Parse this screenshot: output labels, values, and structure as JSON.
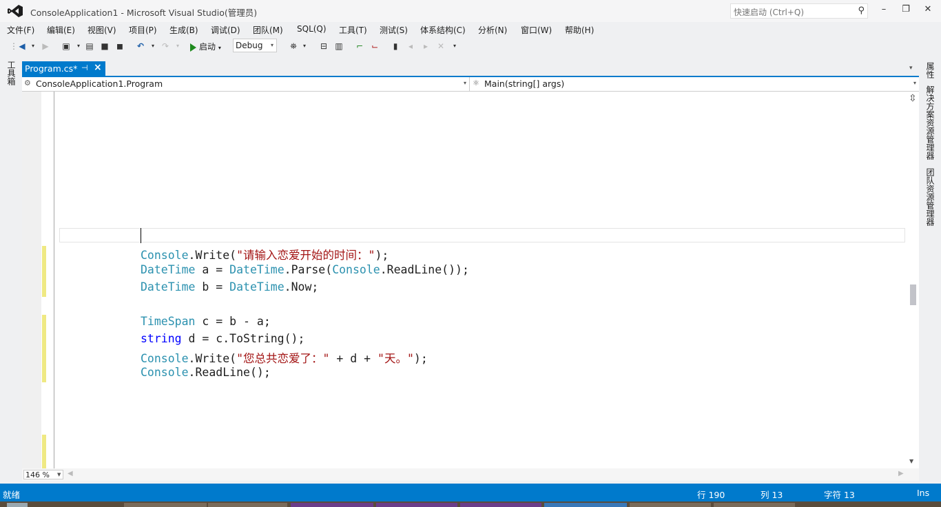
{
  "window": {
    "title": "ConsoleApplication1 - Microsoft Visual Studio(管理员)",
    "quick_launch_placeholder": "快速启动 (Ctrl+Q)"
  },
  "menu": [
    "文件(F)",
    "编辑(E)",
    "视图(V)",
    "项目(P)",
    "生成(B)",
    "调试(D)",
    "团队(M)",
    "SQL(Q)",
    "工具(T)",
    "测试(S)",
    "体系结构(C)",
    "分析(N)",
    "窗口(W)",
    "帮助(H)"
  ],
  "toolbar": {
    "start_label": "启动",
    "config_value": "Debug"
  },
  "left_panel": {
    "toolbox_label": "工具箱"
  },
  "right_panel": {
    "labels": [
      "属性",
      "解决方案资源管理器",
      "团队资源管理器"
    ]
  },
  "tab": {
    "label": "Program.cs*"
  },
  "navbar": {
    "class_value": "ConsoleApplication1.Program",
    "member_value": "Main(string[] args)"
  },
  "code": {
    "line1": {
      "a": "Console",
      "b": ".Write(",
      "c": "\"请输入恋爱开始的时间：\"",
      "d": ");"
    },
    "line2": {
      "a": "DateTime",
      "b": " a = ",
      "c": "DateTime",
      "d": ".Parse(",
      "e": "Console",
      "f": ".ReadLine());"
    },
    "line3": {
      "a": "DateTime",
      "b": " b = ",
      "c": "DateTime",
      "d": ".Now;"
    },
    "line4": {
      "a": "TimeSpan",
      "b": " c = b - a;"
    },
    "line5": {
      "a": "string",
      "b": " d = c.ToString();"
    },
    "line6": {
      "a": "Console",
      "b": ".Write(",
      "c": "\"您总共恋爱了：\"",
      "d": " + d + ",
      "e": "\"天。\"",
      "f": ");"
    },
    "line7": {
      "a": "Console",
      "b": ".ReadLine();"
    }
  },
  "zoom": "146 %",
  "status": {
    "ready": "就绪",
    "row": "行 190",
    "col": "列 13",
    "char": "字符 13",
    "mode": "Ins"
  },
  "colors": {
    "accent": "#007acc",
    "keyword": "#0000ff",
    "type": "#2b91af",
    "string": "#a31515",
    "change_marker": "#efe983"
  }
}
